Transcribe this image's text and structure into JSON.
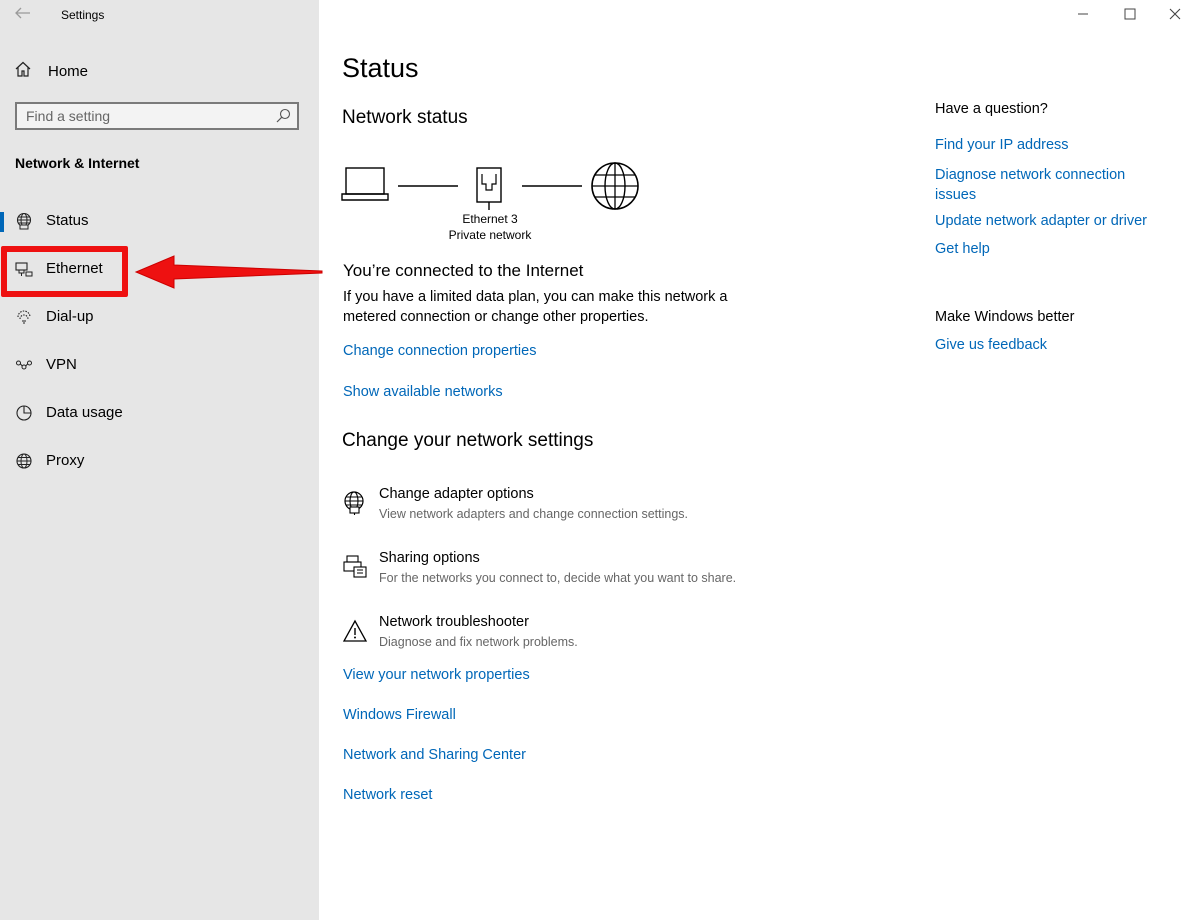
{
  "window": {
    "app_title": "Settings",
    "controls": [
      "minimize",
      "maximize",
      "close"
    ]
  },
  "sidebar": {
    "home_label": "Home",
    "search_placeholder": "Find a setting",
    "section_heading": "Network & Internet",
    "items": [
      {
        "label": "Status",
        "icon": "globe-status-icon",
        "active": true
      },
      {
        "label": "Ethernet",
        "icon": "ethernet-icon",
        "active": false,
        "annotated": true
      },
      {
        "label": "Dial-up",
        "icon": "dial-up-icon",
        "active": false
      },
      {
        "label": "VPN",
        "icon": "vpn-icon",
        "active": false
      },
      {
        "label": "Data usage",
        "icon": "data-usage-icon",
        "active": false
      },
      {
        "label": "Proxy",
        "icon": "proxy-globe-icon",
        "active": false
      }
    ],
    "annotation_color": "#ee1111",
    "accent_color": "#0067b8"
  },
  "main": {
    "page_title": "Status",
    "network_status_heading": "Network status",
    "network_name": "Ethernet 3",
    "network_type": "Private network",
    "connected_title": "You’re connected to the Internet",
    "connected_body": "If you have a limited data plan, you can make this network a metered connection or change other properties.",
    "links_top": [
      "Change connection properties",
      "Show available networks"
    ],
    "change_settings_heading": "Change your network settings",
    "settings": [
      {
        "title": "Change adapter options",
        "subtitle": "View network adapters and change connection settings.",
        "icon": "adapter-globe-icon"
      },
      {
        "title": "Sharing options",
        "subtitle": "For the networks you connect to, decide what you want to share.",
        "icon": "sharing-icon"
      },
      {
        "title": "Network troubleshooter",
        "subtitle": "Diagnose and fix network problems.",
        "icon": "warning-icon"
      }
    ],
    "links_bottom": [
      "View your network properties",
      "Windows Firewall",
      "Network and Sharing Center",
      "Network reset"
    ]
  },
  "rail": {
    "question_heading": "Have a question?",
    "help_links": [
      "Find your IP address",
      "Diagnose network connection issues",
      "Update network adapter or driver",
      "Get help"
    ],
    "better_heading": "Make Windows better",
    "feedback_link": "Give us feedback"
  }
}
